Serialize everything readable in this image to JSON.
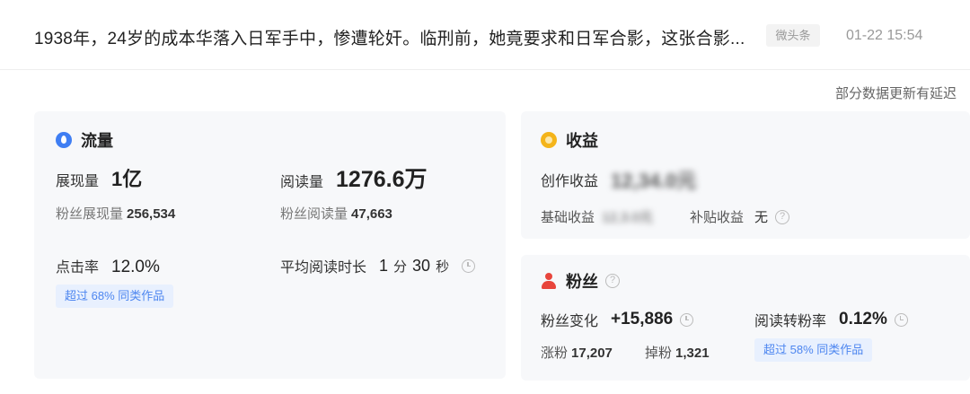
{
  "header": {
    "article_title": "1938年，24岁的成本华落入日军手中，惨遭轮奸。临刑前，她竟要求和日军合影，这张合影...",
    "source_tag": "微头条",
    "publish_time": "01-22 15:54"
  },
  "delay_note": "部分数据更新有延迟",
  "traffic": {
    "title": "流量",
    "icon": "drop-icon",
    "impressions_label": "展现量",
    "impressions_value": "1亿",
    "fan_impressions_label": "粉丝展现量",
    "fan_impressions_value": "256,534",
    "reads_label": "阅读量",
    "reads_value": "1276.6万",
    "fan_reads_label": "粉丝阅读量",
    "fan_reads_value": "47,663",
    "ctr_label": "点击率",
    "ctr_value": "12.0%",
    "ctr_badge": "超过 68% 同类作品",
    "avg_read_label": "平均阅读时长",
    "avg_read_minutes": "1",
    "avg_read_minute_unit": "分",
    "avg_read_seconds": "30",
    "avg_read_second_unit": "秒"
  },
  "income": {
    "title": "收益",
    "icon": "coin-icon",
    "creation_income_label": "创作收益",
    "creation_income_value": "12,34.0元",
    "base_income_label": "基础收益",
    "base_income_value": "12,3.0元",
    "subsidy_label": "补贴收益",
    "subsidy_value": "无"
  },
  "fans": {
    "title": "粉丝",
    "icon": "person-icon",
    "change_label": "粉丝变化",
    "change_value": "+15,886",
    "conversion_label": "阅读转粉率",
    "conversion_value": "0.12%",
    "gained_label": "涨粉",
    "gained_value": "17,207",
    "lost_label": "掉粉",
    "lost_value": "1,321",
    "conversion_badge": "超过 58% 同类作品"
  }
}
